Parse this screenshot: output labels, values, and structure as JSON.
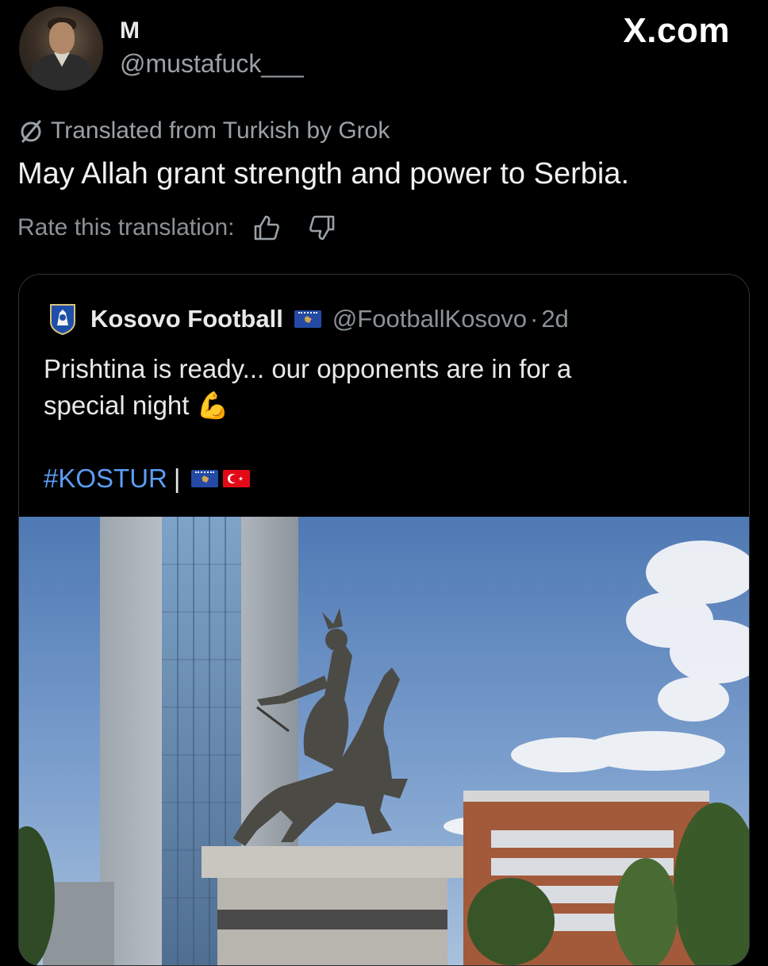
{
  "author": {
    "display_name": "M",
    "handle": "@mustafuck___"
  },
  "brand": "X.com",
  "translation": {
    "note": "Translated from Turkish by Grok",
    "text": "May Allah grant strength and power to Serbia.",
    "rate_label": "Rate this translation:"
  },
  "quoted": {
    "name": "Kosovo Football",
    "handle": "@FootballKosovo",
    "dot": "·",
    "time": "2d",
    "text_line1": "Prishtina is ready... our opponents are in for a",
    "text_line2": "special night",
    "emoji": "💪",
    "hashtag": "#KOSTUR",
    "separator": "|"
  },
  "colors": {
    "background": "#000000",
    "text": "#e7e9ea",
    "muted": "#8b9296",
    "link": "#5a9ef5",
    "border": "#2f3336"
  },
  "icons": [
    "grok-slash-icon",
    "thumbs-up-icon",
    "thumbs-down-icon",
    "kosovo-flag-icon",
    "turkey-flag-icon",
    "ffk-crest-icon"
  ]
}
